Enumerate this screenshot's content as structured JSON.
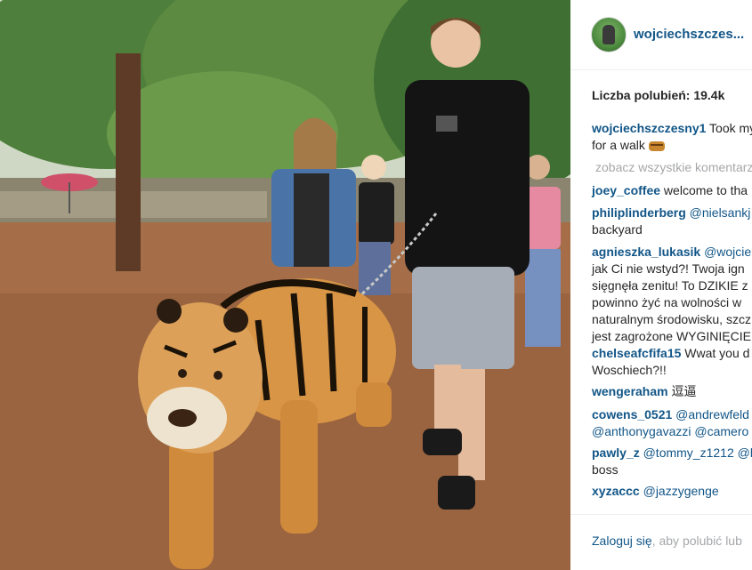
{
  "photo": {
    "alt": ""
  },
  "header": {
    "avatar_icon": "profile-avatar",
    "username": "wojciechszczes..."
  },
  "likes": {
    "text": "Liczba polubień: 19.4k"
  },
  "caption": {
    "user": "wojciechszczesny1",
    "text_line1": " Took my",
    "text_line2": "for a walk",
    "emoji_icon": "tiger-emoji"
  },
  "view_all": "zobacz wszystkie komentarze",
  "comments": [
    {
      "user": "joey_coffee",
      "mention": "",
      "text": " welcome to tha"
    },
    {
      "user": "philiplinderberg",
      "mention": " @nielsankj",
      "text": "backyard"
    },
    {
      "user": "agnieszka_lukasik",
      "mention": " @wojcie",
      "text": "jak Ci nie wstyd?! Twoja ign sięgnęła zenitu! To DZIKIE z powinno żyć na wolności w naturalnym środowisku, szcz jest zagrożone WYGINIĘCIE"
    },
    {
      "user": "chelseafcfifa15",
      "mention": "",
      "text": " Wwat you d Woschiech?!!"
    },
    {
      "user": "wengeraham",
      "mention": "",
      "text": " 逗逼"
    },
    {
      "user": "cowens_0521",
      "mention": " @andrewfeld",
      "text": "@anthonygavazzi @camero"
    },
    {
      "user": "pawly_z",
      "mention": " @tommy_z1212 @b",
      "text": "boss"
    },
    {
      "user": "xyzaccc",
      "mention": " @jazzygenge",
      "text": ""
    }
  ],
  "footer": {
    "login_link": "Zaloguj się",
    "login_rest": ", aby polubić lub"
  },
  "colors": {
    "link": "#125688",
    "text": "#262626",
    "muted": "#a5a7aa"
  }
}
